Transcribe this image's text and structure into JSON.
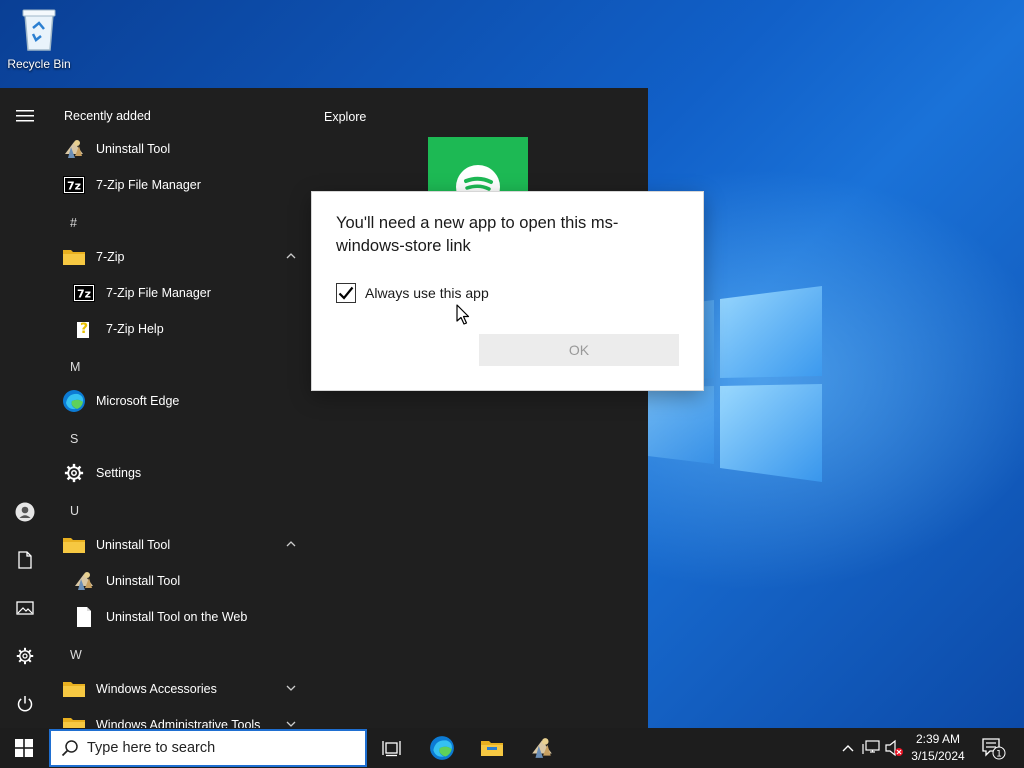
{
  "desktop": {
    "recycle_bin_label": "Recycle Bin"
  },
  "start_menu": {
    "recently_added_title": "Recently added",
    "recent_items": [
      {
        "label": "Uninstall Tool",
        "icon": "uninstall-tool-icon"
      },
      {
        "label": "7-Zip File Manager",
        "icon": "7zip-icon"
      }
    ],
    "letters": [
      "#",
      "M",
      "S",
      "U",
      "W"
    ],
    "groups": {
      "hash": [
        {
          "label": "7-Zip",
          "icon": "folder-icon",
          "expanded": true
        },
        {
          "label": "7-Zip File Manager",
          "icon": "7zip-icon"
        },
        {
          "label": "7-Zip Help",
          "icon": "help-icon"
        }
      ],
      "m": [
        {
          "label": "Microsoft Edge",
          "icon": "edge-icon"
        }
      ],
      "s": [
        {
          "label": "Settings",
          "icon": "gear-icon"
        }
      ],
      "u": [
        {
          "label": "Uninstall Tool",
          "icon": "folder-icon",
          "expanded": true
        },
        {
          "label": "Uninstall Tool",
          "icon": "uninstall-tool-icon"
        },
        {
          "label": "Uninstall Tool on the Web",
          "icon": "document-icon"
        }
      ],
      "w": [
        {
          "label": "Windows Accessories",
          "icon": "folder-icon",
          "expanded": false
        },
        {
          "label": "Windows Administrative Tools",
          "icon": "folder-icon",
          "expanded": false
        }
      ]
    },
    "explore_title": "Explore",
    "tiles": [
      {
        "icon": "spotify-icon"
      }
    ],
    "rail": [
      "hamburger-icon",
      "user-icon",
      "document-icon",
      "pictures-icon",
      "gear-icon",
      "power-icon"
    ]
  },
  "dialog": {
    "title": "You'll need a new app to open this ms-windows-store link",
    "checkbox_label": "Always use this app",
    "checkbox_checked": true,
    "ok_label": "OK"
  },
  "taskbar": {
    "search_placeholder": "Type here to search",
    "pinned": [
      "task-view-icon",
      "edge-icon",
      "file-explorer-icon",
      "uninstall-tool-icon"
    ],
    "clock_time": "2:39 AM",
    "clock_date": "3/15/2024",
    "notification_count": "1"
  },
  "colors": {
    "start_bg": "#1f1f1f",
    "taskbar_bg": "#1d1d1d",
    "accent": "#1f6fd1",
    "spotify": "#1db954",
    "folder": "#f2c12e"
  }
}
